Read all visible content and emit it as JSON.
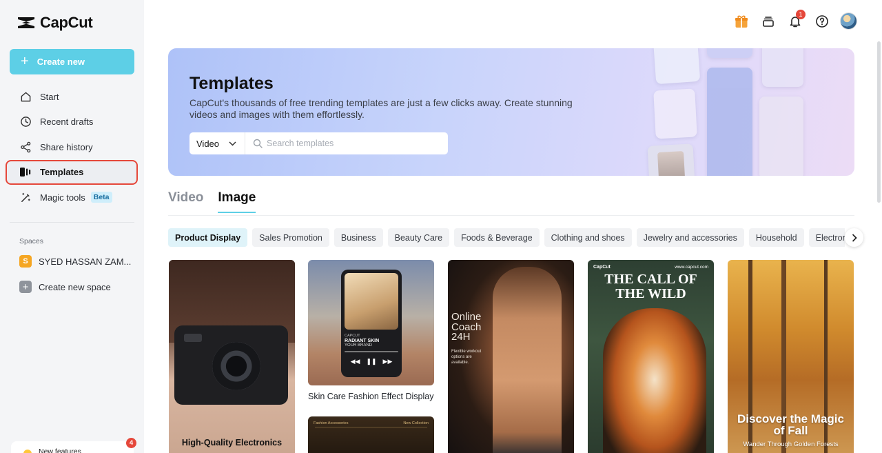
{
  "app": {
    "name": "CapCut"
  },
  "sidebar": {
    "create_label": "Create new",
    "items": [
      {
        "label": "Start",
        "icon": "home-icon"
      },
      {
        "label": "Recent drafts",
        "icon": "clock-icon"
      },
      {
        "label": "Share history",
        "icon": "share-icon"
      },
      {
        "label": "Templates",
        "icon": "templates-icon",
        "active": true
      },
      {
        "label": "Magic tools",
        "icon": "magic-wand-icon",
        "badge": "Beta"
      }
    ],
    "spaces_label": "Spaces",
    "spaces": [
      {
        "initial": "S",
        "name": "SYED HASSAN ZAM...",
        "color": "#f5a623"
      }
    ],
    "create_space_label": "Create new space",
    "new_features_label": "New features",
    "new_features_count": "4"
  },
  "topbar": {
    "notification_count": "1"
  },
  "hero": {
    "title": "Templates",
    "subtitle": "CapCut's thousands of free trending templates are just a few clicks away. Create stunning videos and images with them effortlessly.",
    "type_selected": "Video",
    "search_placeholder": "Search templates"
  },
  "tabs": [
    {
      "label": "Video",
      "active": false
    },
    {
      "label": "Image",
      "active": true
    }
  ],
  "categories": [
    {
      "label": "Product Display",
      "active": true
    },
    {
      "label": "Sales Promotion"
    },
    {
      "label": "Business"
    },
    {
      "label": "Beauty Care"
    },
    {
      "label": "Foods & Beverage"
    },
    {
      "label": "Clothing and shoes"
    },
    {
      "label": "Jewelry and accessories"
    },
    {
      "label": "Household"
    },
    {
      "label": "Electronics"
    }
  ],
  "templates": {
    "t1": {
      "overlay": "High-Quality Electronics"
    },
    "t2": {
      "caption": "Skin Care Fashion Effect Display",
      "brand_small": "CAPCUT",
      "headline": "RADIANT SKIN",
      "sub": "YOUR BRAND"
    },
    "t3": {
      "headline": "Online Coach 24H",
      "body": "Flexible workout options are available."
    },
    "t4": {
      "brand": "CapCut",
      "url": "www.capcut.com",
      "headline": "THE CALL OF THE WILD"
    },
    "t5": {
      "headline": "Discover the Magic of Fall",
      "sub": "Wander Through Golden Forests"
    },
    "t6": {
      "left": "Fashion Accessories",
      "right": "New Collection"
    }
  },
  "colors": {
    "accent": "#5dcfe6",
    "highlight_border": "#e5473a",
    "sidebar_bg": "#f4f5f7"
  }
}
